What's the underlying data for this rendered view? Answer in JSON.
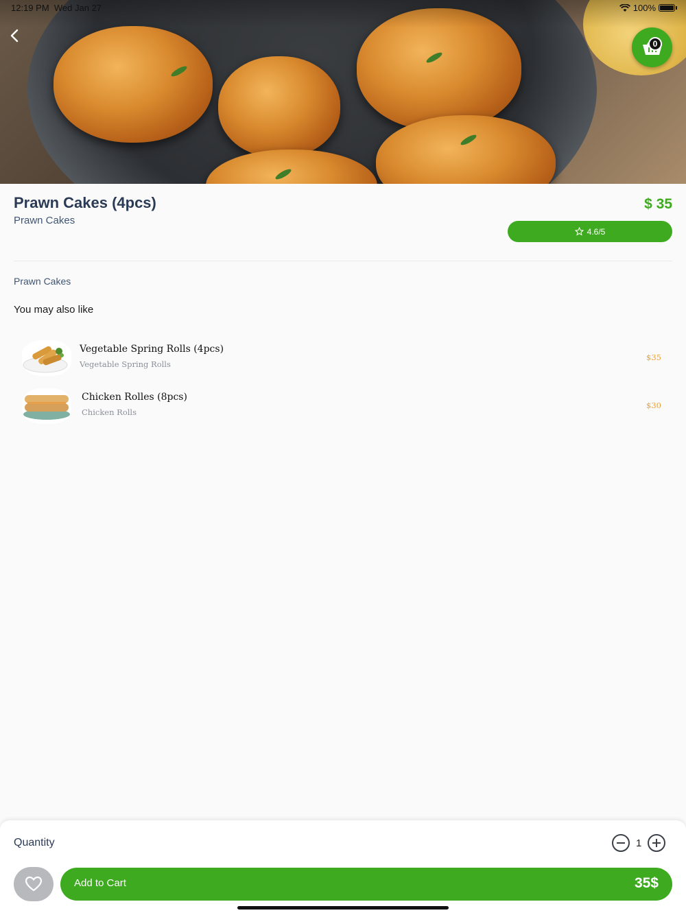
{
  "status_bar": {
    "time": "12:19 PM",
    "date": "Wed Jan 27",
    "battery": "100%",
    "battery_level": 1.0
  },
  "cart": {
    "count": "0"
  },
  "product": {
    "title": "Prawn Cakes (4pcs)",
    "subtitle": "Prawn Cakes",
    "price": "$ 35",
    "rating": "4.6/5",
    "description": "Prawn Cakes"
  },
  "suggestions": {
    "title": "You may also like",
    "items": [
      {
        "name": "Vegetable Spring Rolls (4pcs)",
        "description": "Vegetable Spring Rolls",
        "price": "$35"
      },
      {
        "name": "Chicken Rolles (8pcs)",
        "description": "Chicken Rolls",
        "price": "$30"
      }
    ]
  },
  "bottom": {
    "quantity_label": "Quantity",
    "quantity_value": "1",
    "add_to_cart_label": "Add to Cart",
    "total": "35$"
  },
  "colors": {
    "accent": "#3daa1f",
    "price_orange": "#e8a23a",
    "heading": "#2b3a55"
  },
  "icons": [
    "back-icon",
    "cart-basket-icon",
    "wifi-icon",
    "battery-icon",
    "star-icon",
    "minus-circle-icon",
    "plus-circle-icon",
    "heart-icon"
  ]
}
